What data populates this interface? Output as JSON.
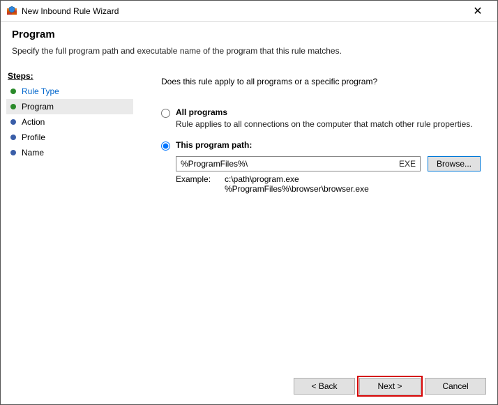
{
  "window": {
    "title": "New Inbound Rule Wizard"
  },
  "header": {
    "title": "Program",
    "description": "Specify the full program path and executable name of the program that this rule matches."
  },
  "sidebar": {
    "heading": "Steps:",
    "items": [
      {
        "label": "Rule Type"
      },
      {
        "label": "Program"
      },
      {
        "label": "Action"
      },
      {
        "label": "Profile"
      },
      {
        "label": "Name"
      }
    ]
  },
  "main": {
    "question": "Does this rule apply to all programs or a specific program?",
    "option_all": {
      "label": "All programs",
      "description": "Rule applies to all connections on the computer that match other rule properties."
    },
    "option_path": {
      "label": "This program path:",
      "value": "%ProgramFiles%\\",
      "extension_hint": "EXE",
      "browse": "Browse...",
      "example_label": "Example:",
      "example_paths": "c:\\path\\program.exe\n%ProgramFiles%\\browser\\browser.exe"
    }
  },
  "footer": {
    "back": "< Back",
    "next": "Next >",
    "cancel": "Cancel"
  }
}
